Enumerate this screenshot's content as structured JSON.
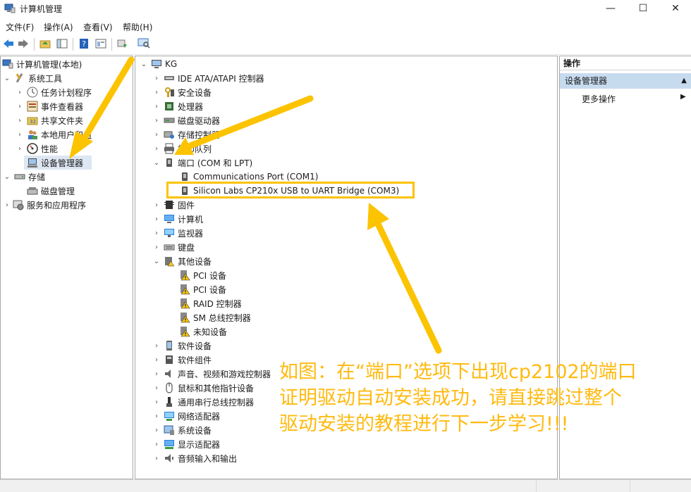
{
  "window": {
    "title": "计算机管理",
    "minimize": "—",
    "maximize": "☐",
    "close": "✕"
  },
  "menu": [
    "文件(F)",
    "操作(A)",
    "查看(V)",
    "帮助(H)"
  ],
  "left_tree": [
    {
      "label": "计算机管理(本地)",
      "icon": "computer-management-icon"
    },
    {
      "label": "系统工具",
      "icon": "system-tools-icon"
    },
    {
      "label": "任务计划程序",
      "icon": "clock-icon"
    },
    {
      "label": "事件查看器",
      "icon": "event-viewer-icon"
    },
    {
      "label": "共享文件夹",
      "icon": "shared-folder-icon"
    },
    {
      "label": "本地用户和组",
      "icon": "users-icon"
    },
    {
      "label": "性能",
      "icon": "performance-icon"
    },
    {
      "label": "设备管理器",
      "icon": "device-manager-icon"
    },
    {
      "label": "存储",
      "icon": "storage-icon"
    },
    {
      "label": "磁盘管理",
      "icon": "disk-management-icon"
    },
    {
      "label": "服务和应用程序",
      "icon": "services-icon"
    }
  ],
  "device_tree": {
    "root": "KG",
    "nodes": [
      {
        "label": "IDE ATA/ATAPI 控制器",
        "icon": "ide-controller-icon"
      },
      {
        "label": "安全设备",
        "icon": "security-device-icon"
      },
      {
        "label": "处理器",
        "icon": "processor-icon"
      },
      {
        "label": "磁盘驱动器",
        "icon": "disk-drive-icon"
      },
      {
        "label": "存储控制器",
        "icon": "storage-controller-icon"
      },
      {
        "label": "打印队列",
        "icon": "printer-icon"
      },
      {
        "label": "端口 (COM 和 LPT)",
        "icon": "port-icon"
      },
      {
        "label": "Communications Port (COM1)",
        "icon": "port-icon"
      },
      {
        "label": "Silicon Labs CP210x USB to UART Bridge (COM3)",
        "icon": "port-icon"
      },
      {
        "label": "固件",
        "icon": "firmware-icon"
      },
      {
        "label": "计算机",
        "icon": "computer-icon"
      },
      {
        "label": "监视器",
        "icon": "monitor-icon"
      },
      {
        "label": "键盘",
        "icon": "keyboard-icon"
      },
      {
        "label": "其他设备",
        "icon": "other-devices-icon"
      },
      {
        "label": "PCI 设备",
        "icon": "warning-device-icon"
      },
      {
        "label": "PCI 设备",
        "icon": "warning-device-icon"
      },
      {
        "label": "RAID 控制器",
        "icon": "warning-device-icon"
      },
      {
        "label": "SM 总线控制器",
        "icon": "warning-device-icon"
      },
      {
        "label": "未知设备",
        "icon": "warning-device-icon"
      },
      {
        "label": "软件设备",
        "icon": "software-device-icon"
      },
      {
        "label": "软件组件",
        "icon": "software-component-icon"
      },
      {
        "label": "声音、视频和游戏控制器",
        "icon": "sound-icon"
      },
      {
        "label": "鼠标和其他指针设备",
        "icon": "mouse-icon"
      },
      {
        "label": "通用串行总线控制器",
        "icon": "usb-icon"
      },
      {
        "label": "网络适配器",
        "icon": "network-adapter-icon"
      },
      {
        "label": "系统设备",
        "icon": "system-device-icon"
      },
      {
        "label": "显示适配器",
        "icon": "display-adapter-icon"
      },
      {
        "label": "音频输入和输出",
        "icon": "audio-io-icon"
      }
    ]
  },
  "actions": {
    "header": "操作",
    "section": "设备管理器",
    "more": "更多操作"
  },
  "annotation": {
    "line1": "如图：在“端口”选项下出现cp2102的端口",
    "line2": "证明驱动自动安装成功，请直接跳过整个",
    "line3": "驱动安装的教程进行下一步学习!!!"
  },
  "colors": {
    "annotation": "#ffba10",
    "arrow": "#fcc300",
    "selection": "#dde7f3",
    "actions_section": "#c7dbef"
  }
}
